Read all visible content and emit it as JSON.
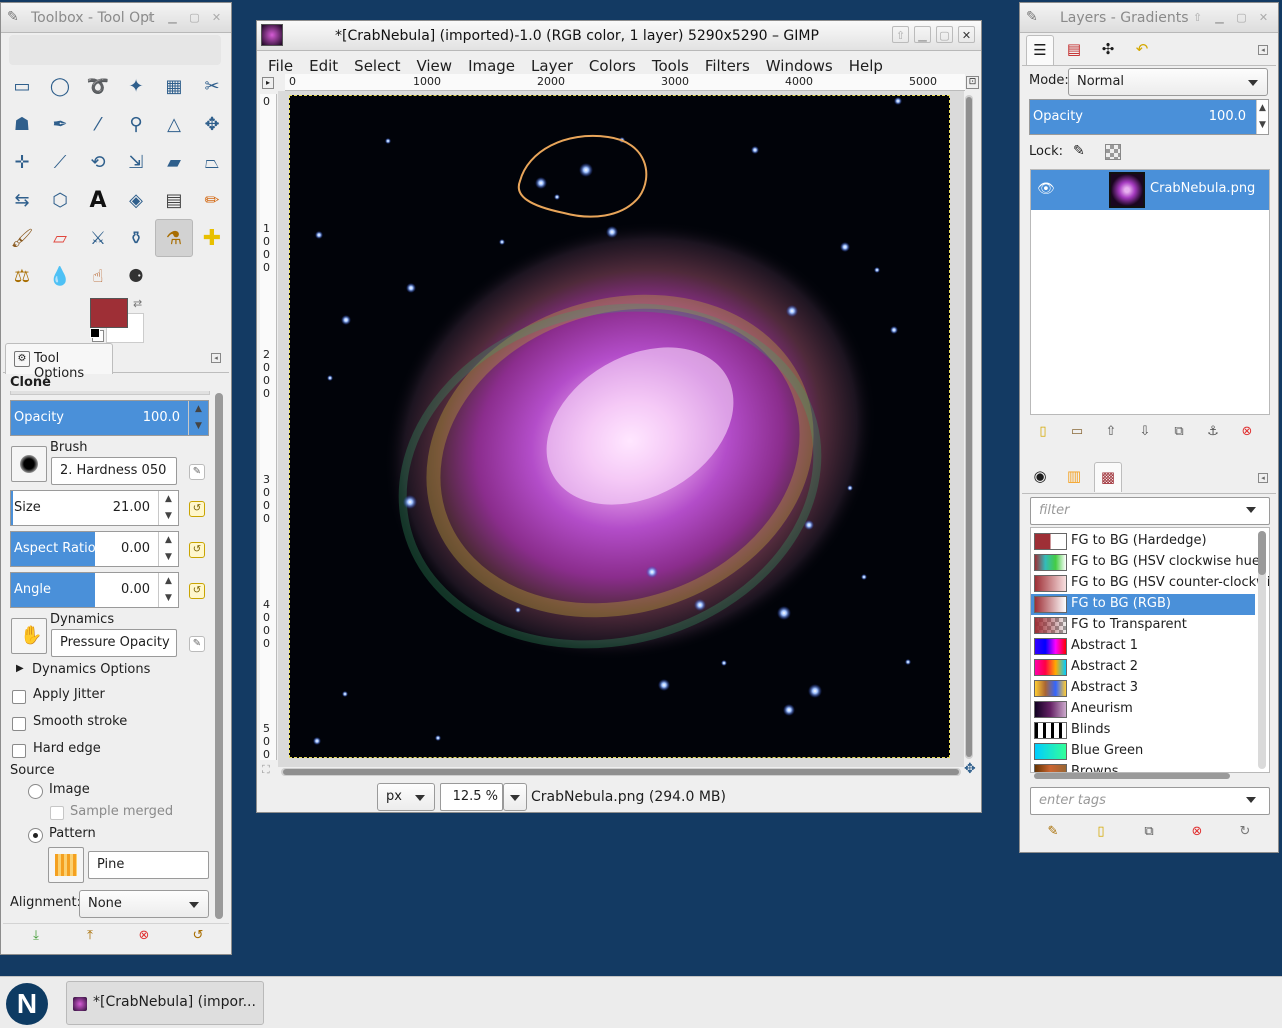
{
  "toolbox": {
    "title": "Toolbox - Tool Opt",
    "tool_options_tab": "Tool Options",
    "tool_name": "Clone",
    "opacity": {
      "label": "Opacity",
      "value": "100.0"
    },
    "brush": {
      "label": "Brush",
      "value": "2. Hardness 050"
    },
    "size": {
      "label": "Size",
      "value": "21.00"
    },
    "aspect_ratio": {
      "label": "Aspect Ratio",
      "value": "0.00"
    },
    "angle": {
      "label": "Angle",
      "value": "0.00"
    },
    "dynamics": {
      "label": "Dynamics",
      "value": "Pressure Opacity"
    },
    "dynamics_options": "Dynamics Options",
    "apply_jitter": "Apply Jitter",
    "smooth_stroke": "Smooth stroke",
    "hard_edge": "Hard edge",
    "source_label": "Source",
    "source_image": "Image",
    "sample_merged": "Sample merged",
    "source_pattern": "Pattern",
    "pattern_name": "Pine",
    "alignment_label": "Alignment:",
    "alignment_value": "None",
    "fg_color": "#9e2f36",
    "bg_color": "#ffffff"
  },
  "image_window": {
    "title": "*[CrabNebula] (imported)-1.0 (RGB color, 1 layer) 5290x5290 – GIMP",
    "menus": [
      "File",
      "Edit",
      "Select",
      "View",
      "Image",
      "Layer",
      "Colors",
      "Tools",
      "Filters",
      "Windows",
      "Help"
    ],
    "ruler_h": [
      "0",
      "1000",
      "2000",
      "3000",
      "4000",
      "5000"
    ],
    "ruler_v": [
      "0",
      "1000",
      "2000",
      "3000",
      "4000",
      "5000"
    ],
    "unit": "px",
    "zoom": "12.5 %",
    "status": "CrabNebula.png (294.0 MB)"
  },
  "layers_dock": {
    "title": "Layers - Gradients",
    "mode_label": "Mode:",
    "mode_value": "Normal",
    "opacity": {
      "label": "Opacity",
      "value": "100.0"
    },
    "lock_label": "Lock:",
    "layer_name": "CrabNebula.png",
    "filter_placeholder": "filter",
    "tags_placeholder": "enter tags",
    "gradients": [
      {
        "name": "FG to BG (Hardedge)",
        "selected": false
      },
      {
        "name": "FG to BG (HSV clockwise hue)",
        "selected": false
      },
      {
        "name": "FG to BG (HSV counter-clockwise)",
        "selected": false
      },
      {
        "name": "FG to BG (RGB)",
        "selected": true
      },
      {
        "name": "FG to Transparent",
        "selected": false
      },
      {
        "name": "Abstract 1",
        "selected": false
      },
      {
        "name": "Abstract 2",
        "selected": false
      },
      {
        "name": "Abstract 3",
        "selected": false
      },
      {
        "name": "Aneurism",
        "selected": false
      },
      {
        "name": "Blinds",
        "selected": false
      },
      {
        "name": "Blue Green",
        "selected": false
      },
      {
        "name": "Browns",
        "selected": false
      }
    ]
  },
  "taskbar": {
    "logo": "N",
    "task_label": "*[CrabNebula] (impor..."
  }
}
